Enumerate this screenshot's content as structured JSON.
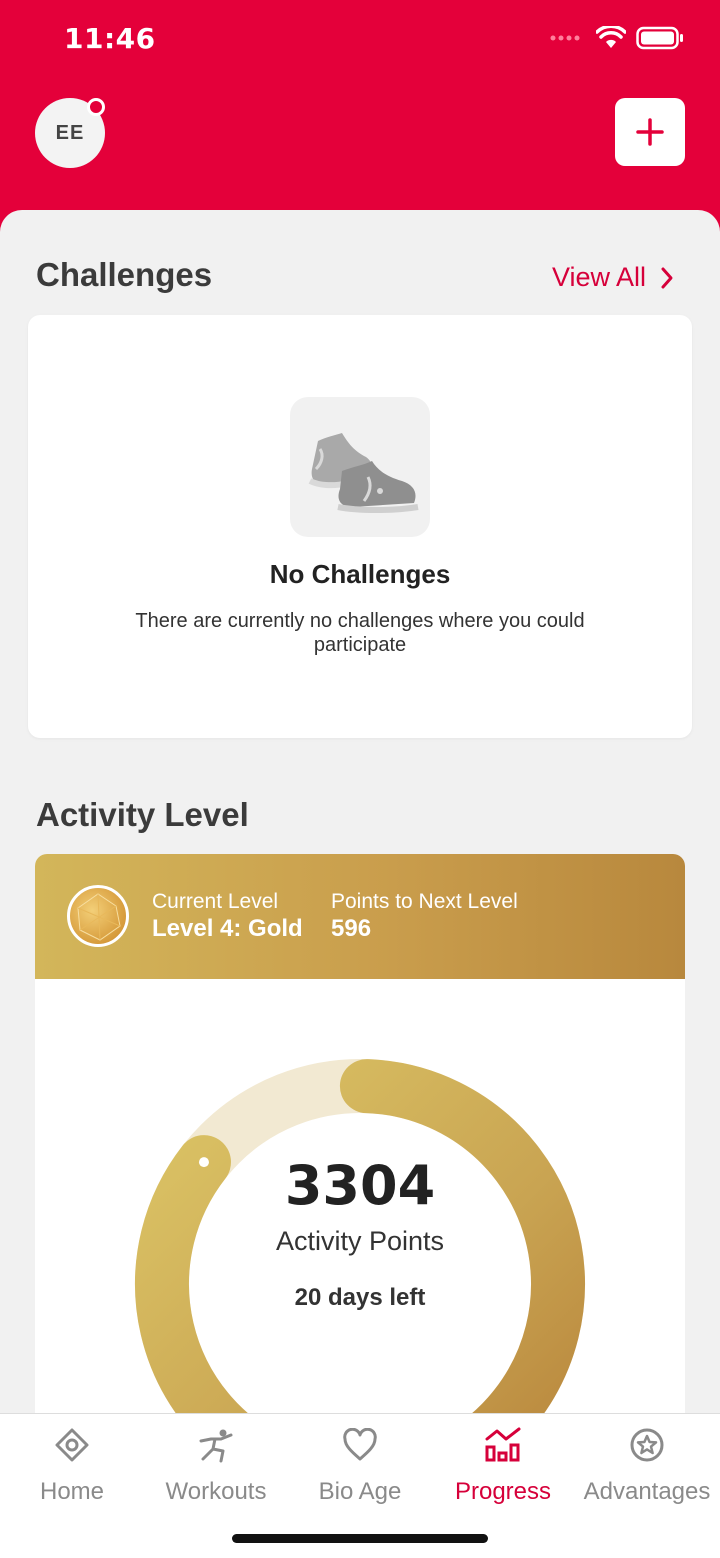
{
  "status_bar": {
    "time": "11:46"
  },
  "header": {
    "avatar_initials": "EE",
    "add_label": "+"
  },
  "challenges": {
    "title": "Challenges",
    "view_all": "View All",
    "empty_title": "No Challenges",
    "empty_text": "There are currently no challenges where you could participate"
  },
  "activity_level": {
    "title": "Activity Level",
    "current_level_label": "Current Level",
    "current_level_value": "Level 4: Gold",
    "points_next_label": "Points to Next Level",
    "points_next_value": "596",
    "points": "3304",
    "points_label": "Activity Points",
    "days_left": "20 days left",
    "progress_fraction": 0.85
  },
  "tabs": [
    {
      "label": "Home",
      "icon": "home-icon"
    },
    {
      "label": "Workouts",
      "icon": "workouts-icon"
    },
    {
      "label": "Bio Age",
      "icon": "heart-icon"
    },
    {
      "label": "Progress",
      "icon": "progress-chart-icon",
      "active": true
    },
    {
      "label": "Advantages",
      "icon": "star-badge-icon"
    }
  ],
  "colors": {
    "brand": "#e4003a",
    "gold": "#c99d4c",
    "gold_light": "#f2e9d2"
  }
}
